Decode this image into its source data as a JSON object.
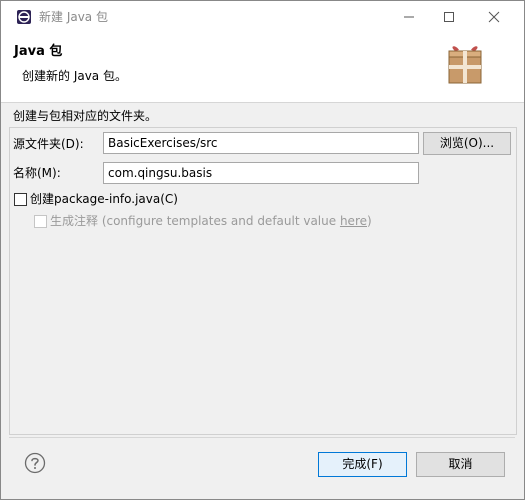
{
  "window": {
    "title": "新建 Java 包"
  },
  "banner": {
    "title": "Java 包",
    "description": "创建新的 Java 包。",
    "icon": "package-icon"
  },
  "form": {
    "section_label": "创建与包相对应的文件夹。",
    "source_folder_label": "源文件夹(D):",
    "source_folder_value": "BasicExercises/src",
    "browse_label": "浏览(O)...",
    "name_label": "名称(M):",
    "name_value": "com.qingsu.basis",
    "create_package_info": {
      "label": "创建package-info.java(C)",
      "checked": false
    },
    "generate_comments": {
      "label_prefix": "生成注释 (configure templates and default value ",
      "link": "here",
      "label_suffix": ")",
      "checked": false,
      "enabled": false
    }
  },
  "footer": {
    "help_icon": "help-icon",
    "finish_label": "完成(F)",
    "cancel_label": "取消"
  },
  "colors": {
    "dialog_bg": "#f0f0f0",
    "header_bg": "#ffffff",
    "focus_border": "#0078d7",
    "disabled_text": "#9a9a9a"
  }
}
